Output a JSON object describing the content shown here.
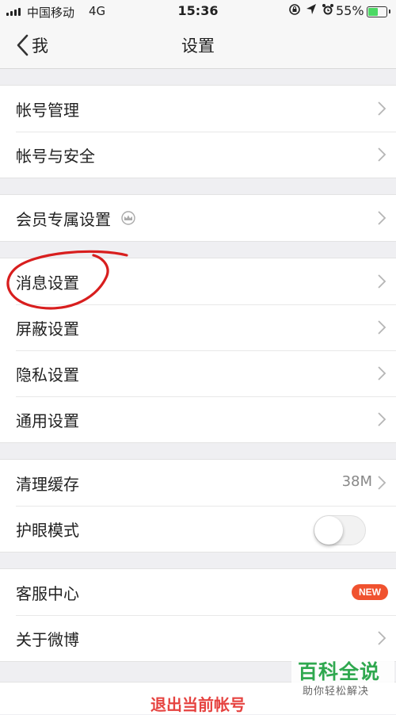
{
  "status_bar": {
    "carrier": "中国移动",
    "network": "4G",
    "time": "15:36",
    "battery_percent": "55%",
    "battery_level": 0.55,
    "icons": [
      "signal-icon",
      "lock-rotation-icon",
      "location-icon",
      "alarm-icon",
      "battery-charging-icon"
    ]
  },
  "nav": {
    "back_label": "我",
    "title": "设置"
  },
  "groups": [
    {
      "items": [
        {
          "label": "帐号管理"
        },
        {
          "label": "帐号与安全"
        }
      ]
    },
    {
      "items": [
        {
          "label": "会员专属设置",
          "icon": "crown-icon"
        }
      ]
    },
    {
      "items": [
        {
          "label": "消息设置",
          "annotated": true
        },
        {
          "label": "屏蔽设置"
        },
        {
          "label": "隐私设置"
        },
        {
          "label": "通用设置"
        }
      ]
    },
    {
      "items": [
        {
          "label": "清理缓存",
          "value": "38M"
        },
        {
          "label": "护眼模式",
          "toggle": false
        }
      ]
    },
    {
      "items": [
        {
          "label": "客服中心",
          "badge": "NEW"
        },
        {
          "label": "关于微博"
        }
      ]
    }
  ],
  "logout": {
    "label": "退出当前帐号"
  },
  "watermark": {
    "title": "百科全说",
    "subtitle": "助你轻松解决"
  },
  "colors": {
    "accent_red": "#e64340",
    "badge": "#f0522f",
    "watermark_green": "#2fa84f",
    "annotation": "#d81e1e"
  }
}
